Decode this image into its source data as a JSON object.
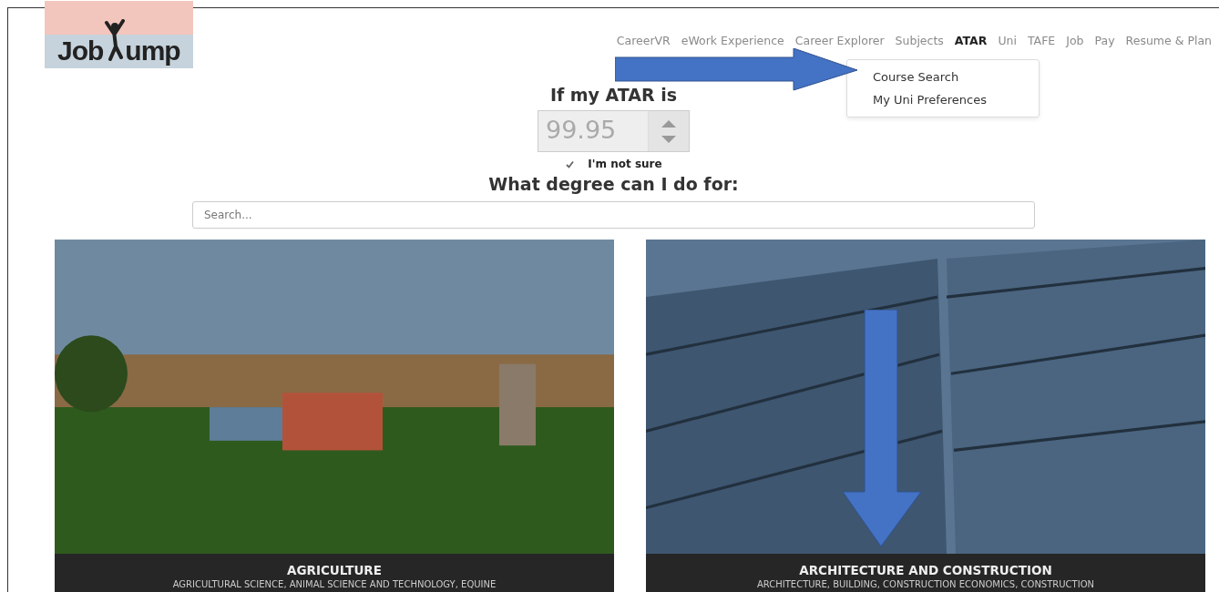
{
  "logo": {
    "left": "Job",
    "right": "ump"
  },
  "nav": [
    {
      "label": "CareerVR",
      "selected": false
    },
    {
      "label": "eWork Experience",
      "selected": false
    },
    {
      "label": "Career Explorer",
      "selected": false
    },
    {
      "label": "Subjects",
      "selected": false
    },
    {
      "label": "ATAR",
      "selected": true
    },
    {
      "label": "Uni",
      "selected": false
    },
    {
      "label": "TAFE",
      "selected": false
    },
    {
      "label": "Job",
      "selected": false
    },
    {
      "label": "Pay",
      "selected": false
    },
    {
      "label": "Resume & Plan",
      "selected": false
    }
  ],
  "dropdown": [
    "Course Search",
    "My Uni Preferences"
  ],
  "atar": {
    "heading": "If my ATAR is",
    "value": "99.95",
    "disabled": true,
    "not_sure": {
      "label": "I'm not sure",
      "checked": true
    }
  },
  "degree": {
    "heading": "What degree can I do for:",
    "search": {
      "placeholder": "Search..."
    }
  },
  "cards": [
    {
      "kind": "farm",
      "title": "AGRICULTURE",
      "subtitle": "AGRICULTURAL SCIENCE, ANIMAL SCIENCE AND TECHNOLOGY, EQUINE"
    },
    {
      "kind": "building",
      "title": "ARCHITECTURE AND CONSTRUCTION",
      "subtitle": "ARCHITECTURE, BUILDING, CONSTRUCTION ECONOMICS, CONSTRUCTION"
    }
  ]
}
